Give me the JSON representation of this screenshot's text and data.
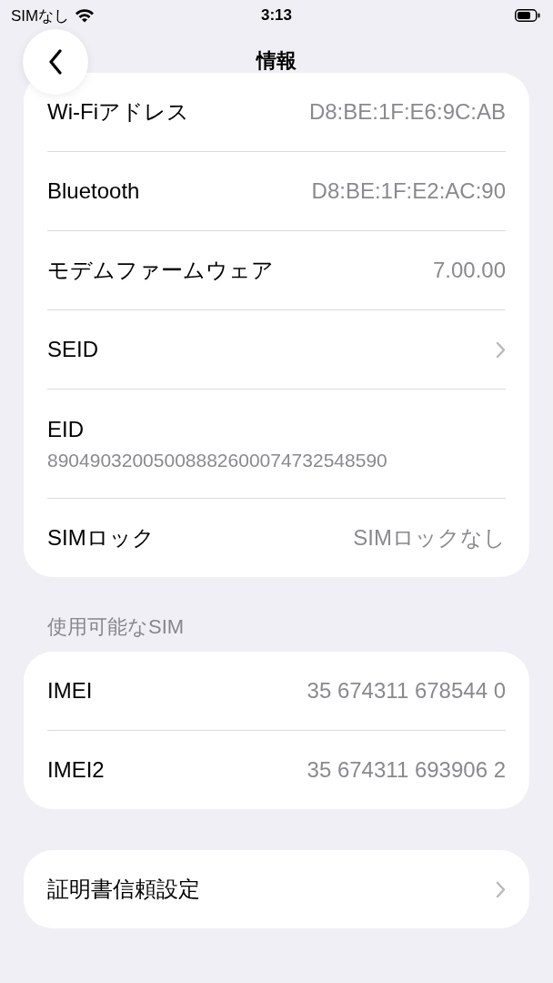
{
  "status_bar": {
    "carrier": "SIMなし",
    "time": "3:13"
  },
  "nav": {
    "title": "情報"
  },
  "sections": [
    {
      "rows": [
        {
          "kind": "value",
          "label": "Wi-Fiアドレス",
          "value": "D8:BE:1F:E6:9C:AB"
        },
        {
          "kind": "value",
          "label": "Bluetooth",
          "value": "D8:BE:1F:E2:AC:90"
        },
        {
          "kind": "value",
          "label": "モデムファームウェア",
          "value": "7.00.00"
        },
        {
          "kind": "link",
          "label": "SEID"
        },
        {
          "kind": "stacked",
          "label": "EID",
          "value": "89049032005008882600074732548590"
        },
        {
          "kind": "value",
          "label": "SIMロック",
          "value": "SIMロックなし"
        }
      ]
    },
    {
      "header": "使用可能なSIM",
      "rows": [
        {
          "kind": "value",
          "label": "IMEI",
          "value": "35 674311 678544 0"
        },
        {
          "kind": "value",
          "label": "IMEI2",
          "value": "35 674311 693906 2"
        }
      ]
    },
    {
      "rows": [
        {
          "kind": "link",
          "label": "証明書信頼設定"
        }
      ]
    }
  ]
}
